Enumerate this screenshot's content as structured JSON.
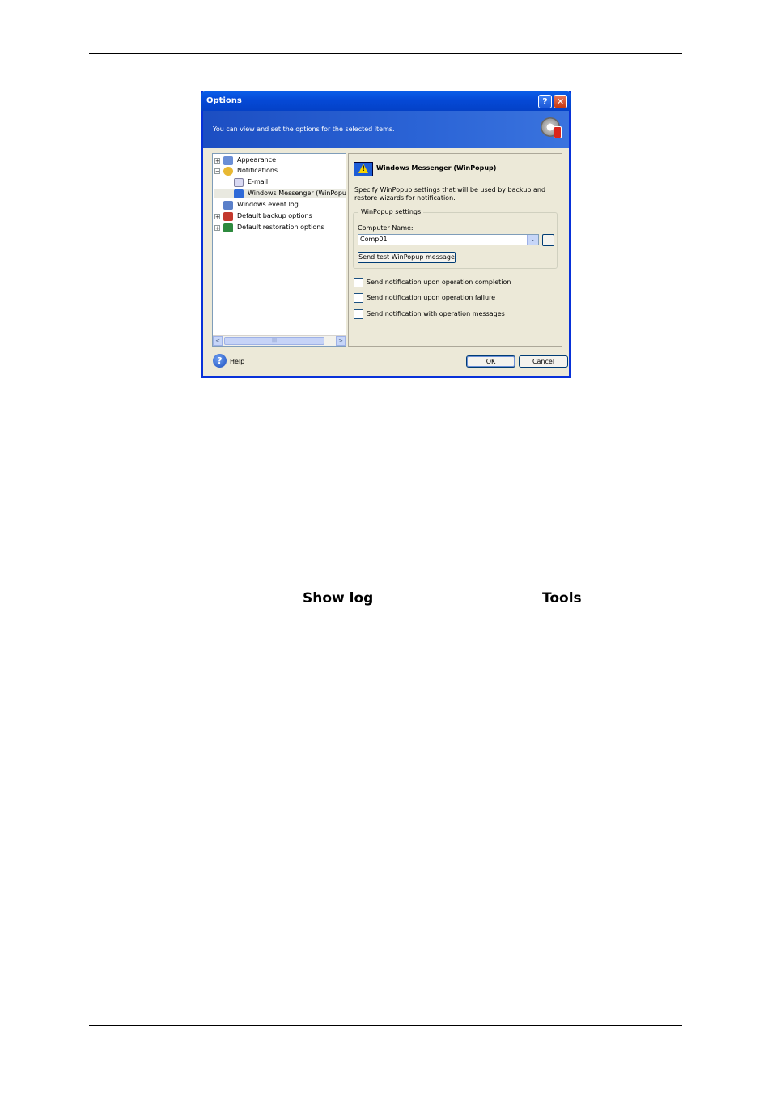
{
  "dialog": {
    "title": "Options",
    "title_help": "?",
    "title_close": "✕",
    "banner_text": "You can view and set the options for the selected items.",
    "tree": [
      {
        "expander": "+",
        "label": "Appearance",
        "icon_color": "#6a8ed6"
      },
      {
        "expander": "−",
        "label": "Notifications",
        "icon_color": "#e8b832"
      },
      {
        "expander": "",
        "label": "E-mail",
        "icon_color": "#d9d9f2"
      },
      {
        "expander": "",
        "label": "Windows Messenger (WinPopu",
        "icon_color": "#2f6ad8"
      },
      {
        "expander": "",
        "label": "Windows event log",
        "icon_color": "#5a7fc9"
      },
      {
        "expander": "+",
        "label": "Default backup options",
        "icon_color": "#c3382d"
      },
      {
        "expander": "+",
        "label": "Default restoration options",
        "icon_color": "#2d8a3e"
      }
    ],
    "scroll_left": "<",
    "scroll_right": ">",
    "scroll_grip": "|||",
    "panel_title": "Windows Messenger (WinPopup)",
    "panel_description": "Specify WinPopup settings that will be used by backup and restore wizards for notification.",
    "group_title": "WinPopup settings",
    "computer_name_label": "Computer Name:",
    "computer_name_value": "Comp01",
    "combo_arrow": "⌄",
    "browse_label": "...",
    "send_test_label": "Send test WinPopup message",
    "checkboxes": [
      {
        "label": "Send notification upon operation completion",
        "checked": false
      },
      {
        "label": "Send notification upon operation failure",
        "checked": false
      },
      {
        "label": "Send notification with operation messages",
        "checked": false
      }
    ],
    "help_icon": "?",
    "help_label": "Help",
    "ok_label": "OK",
    "cancel_label": "Cancel"
  },
  "body_text": {
    "show_log": "Show log",
    "tools": "Tools"
  }
}
